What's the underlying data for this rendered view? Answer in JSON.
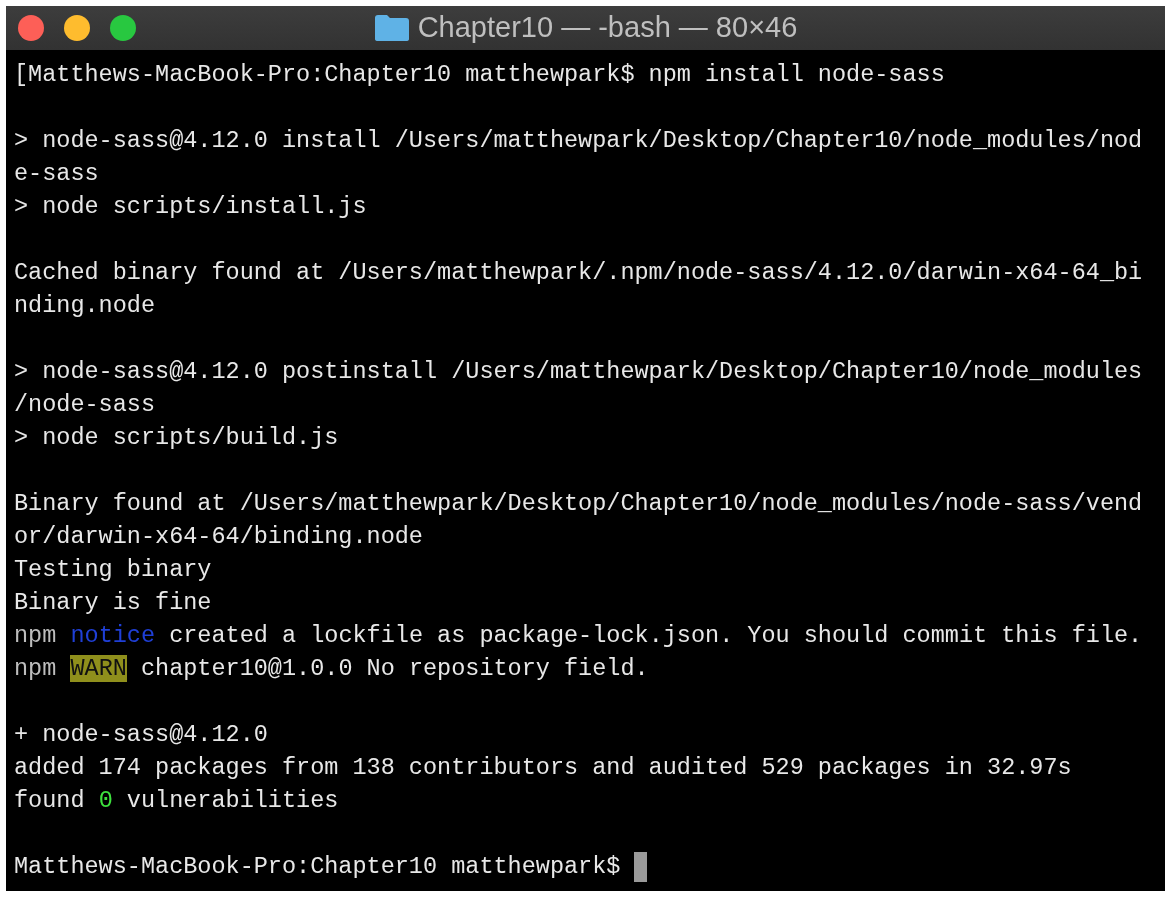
{
  "window": {
    "title": "Chapter10 — -bash — 80×46"
  },
  "terminal": {
    "lines": [
      {
        "kind": "text",
        "segments": [
          {
            "kind": "plain",
            "text": "[Matthews-MacBook-Pro:Chapter10 matthewpark$ npm install node-sass"
          }
        ]
      },
      {
        "kind": "blank"
      },
      {
        "kind": "text",
        "segments": [
          {
            "kind": "plain",
            "text": "> node-sass@4.12.0 install /Users/matthewpark/Desktop/Chapter10/node_modules/nod"
          }
        ]
      },
      {
        "kind": "text",
        "segments": [
          {
            "kind": "plain",
            "text": "e-sass"
          }
        ]
      },
      {
        "kind": "text",
        "segments": [
          {
            "kind": "plain",
            "text": "> node scripts/install.js"
          }
        ]
      },
      {
        "kind": "blank"
      },
      {
        "kind": "text",
        "segments": [
          {
            "kind": "plain",
            "text": "Cached binary found at /Users/matthewpark/.npm/node-sass/4.12.0/darwin-x64-64_bi"
          }
        ]
      },
      {
        "kind": "text",
        "segments": [
          {
            "kind": "plain",
            "text": "nding.node"
          }
        ]
      },
      {
        "kind": "blank"
      },
      {
        "kind": "text",
        "segments": [
          {
            "kind": "plain",
            "text": "> node-sass@4.12.0 postinstall /Users/matthewpark/Desktop/Chapter10/node_modules"
          }
        ]
      },
      {
        "kind": "text",
        "segments": [
          {
            "kind": "plain",
            "text": "/node-sass"
          }
        ]
      },
      {
        "kind": "text",
        "segments": [
          {
            "kind": "plain",
            "text": "> node scripts/build.js"
          }
        ]
      },
      {
        "kind": "blank"
      },
      {
        "kind": "text",
        "segments": [
          {
            "kind": "plain",
            "text": "Binary found at /Users/matthewpark/Desktop/Chapter10/node_modules/node-sass/vend"
          }
        ]
      },
      {
        "kind": "text",
        "segments": [
          {
            "kind": "plain",
            "text": "or/darwin-x64-64/binding.node"
          }
        ]
      },
      {
        "kind": "text",
        "segments": [
          {
            "kind": "plain",
            "text": "Testing binary"
          }
        ]
      },
      {
        "kind": "text",
        "segments": [
          {
            "kind": "plain",
            "text": "Binary is fine"
          }
        ]
      },
      {
        "kind": "text",
        "segments": [
          {
            "kind": "dim",
            "text": "npm"
          },
          {
            "kind": "notice",
            "text": "notice"
          },
          {
            "kind": "plain",
            "text": "created a lockfile as package-lock.json. You should commit this file."
          }
        ]
      },
      {
        "kind": "text",
        "segments": [
          {
            "kind": "dim",
            "text": "npm"
          },
          {
            "kind": "warn",
            "text": "WARN"
          },
          {
            "kind": "plain",
            "text": "chapter10@1.0.0 No repository field."
          }
        ]
      },
      {
        "kind": "blank"
      },
      {
        "kind": "text",
        "segments": [
          {
            "kind": "plain",
            "text": "+ node-sass@4.12.0"
          }
        ]
      },
      {
        "kind": "text",
        "segments": [
          {
            "kind": "plain",
            "text": "added 174 packages from 138 contributors and audited 529 packages in 32.97s"
          }
        ]
      },
      {
        "kind": "text",
        "segments": [
          {
            "kind": "plain",
            "text": "found"
          },
          {
            "kind": "ok",
            "text": "0"
          },
          {
            "kind": "plain",
            "text": "vulnerabilities"
          }
        ]
      },
      {
        "kind": "blank"
      },
      {
        "kind": "prompt",
        "segments": [
          {
            "kind": "plain",
            "text": "Matthews-MacBook-Pro:Chapter10 matthewpark$"
          }
        ]
      }
    ]
  }
}
